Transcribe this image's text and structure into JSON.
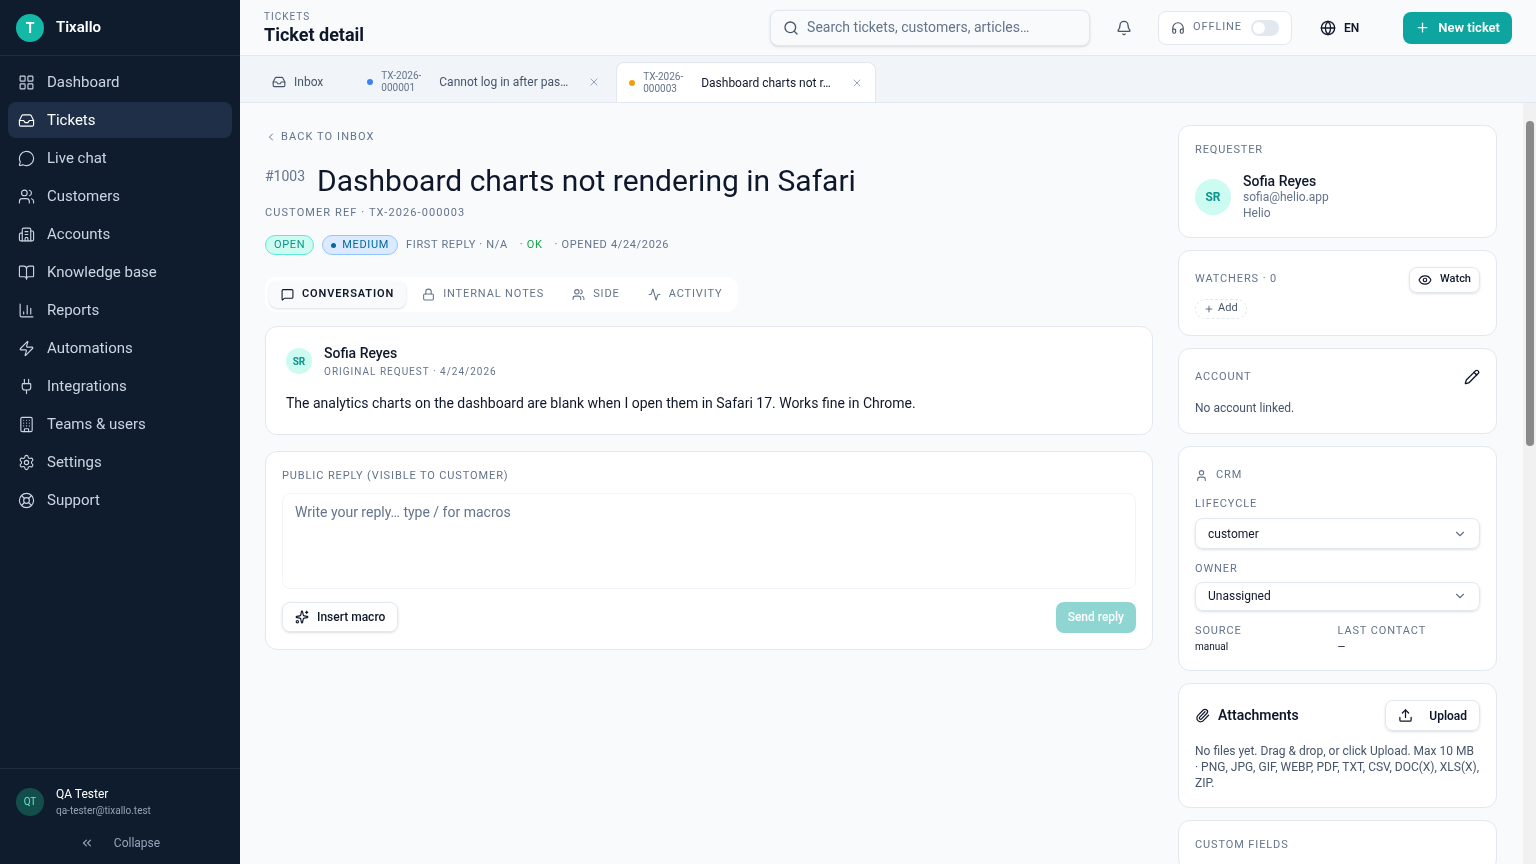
{
  "brand": {
    "logo": "T",
    "name": "Tixallo"
  },
  "sidebar": {
    "items": [
      {
        "label": "Dashboard",
        "selected": false
      },
      {
        "label": "Tickets",
        "selected": true
      },
      {
        "label": "Live chat",
        "selected": false
      },
      {
        "label": "Customers",
        "selected": false
      },
      {
        "label": "Accounts",
        "selected": false
      },
      {
        "label": "Knowledge base",
        "selected": false
      },
      {
        "label": "Reports",
        "selected": false
      },
      {
        "label": "Automations",
        "selected": false
      },
      {
        "label": "Integrations",
        "selected": false
      },
      {
        "label": "Teams & users",
        "selected": false
      },
      {
        "label": "Settings",
        "selected": false
      },
      {
        "label": "Support",
        "selected": false
      }
    ],
    "user": {
      "initials": "QT",
      "name": "QA Tester",
      "email": "qa-tester@tixallo.test"
    },
    "collapse": "Collapse"
  },
  "header": {
    "eyebrow": "TICKETS",
    "title": "Ticket detail",
    "search": {
      "placeholder": "Search tickets, customers, articles…"
    },
    "presence": {
      "label": "OFFLINE",
      "on": false
    },
    "language": "EN",
    "new_button": "New ticket"
  },
  "tabs": [
    {
      "kind": "inbox",
      "label": "Inbox",
      "selected": false
    },
    {
      "kind": "ticket",
      "ref": "TX-2026-000001",
      "label": "Cannot log in after pas…",
      "color": "#3b82f6",
      "selected": false
    },
    {
      "kind": "ticket",
      "ref": "TX-2026-000003",
      "label": "Dashboard charts not r…",
      "color": "#f59e0b",
      "selected": true
    }
  ],
  "ticket": {
    "back": "BACK TO INBOX",
    "number": "#1003",
    "title": "Dashboard charts not rendering in Safari",
    "customer_ref": "CUSTOMER REF · TX-2026-000003",
    "status": "OPEN",
    "priority": "MEDIUM",
    "first_reply": "FIRST REPLY · N/A",
    "sla": "· OK",
    "opened": "· OPENED 4/24/2026",
    "view_tabs": [
      {
        "label": "CONVERSATION",
        "selected": true
      },
      {
        "label": "INTERNAL NOTES",
        "selected": false
      },
      {
        "label": "SIDE",
        "selected": false
      },
      {
        "label": "ACTIVITY",
        "selected": false
      }
    ],
    "message": {
      "initials": "SR",
      "author": "Sofia Reyes",
      "meta": "ORIGINAL REQUEST · 4/24/2026",
      "body": "The analytics charts on the dashboard are blank when I open them in Safari 17. Works fine in Chrome."
    },
    "reply": {
      "label": "PUBLIC REPLY (VISIBLE TO CUSTOMER)",
      "placeholder": "Write your reply… type / for macros",
      "macro_button": "Insert macro",
      "send_button": "Send reply",
      "send_disabled": true
    }
  },
  "details": {
    "requester": {
      "heading": "REQUESTER",
      "initials": "SR",
      "name": "Sofia Reyes",
      "email": "sofia@helio.app",
      "company": "Helio"
    },
    "watchers": {
      "heading": "WATCHERS · 0",
      "watch_button": "Watch",
      "add_button": "Add"
    },
    "account": {
      "heading": "ACCOUNT",
      "text": "No account linked."
    },
    "crm": {
      "heading": "CRM",
      "lifecycle_label": "LIFECYCLE",
      "lifecycle": "customer",
      "owner_label": "OWNER",
      "owner": "Unassigned",
      "source_label": "SOURCE",
      "source": "manual",
      "last_contact_label": "LAST CONTACT",
      "last_contact": "—"
    },
    "attachments": {
      "heading": "Attachments",
      "upload_button": "Upload",
      "text": "No files yet. Drag & drop, or click Upload. Max 10 MB · PNG, JPG, GIF, WEBP, PDF, TXT, CSV, DOC(X), XLS(X), ZIP."
    },
    "custom_fields": {
      "heading": "CUSTOM FIELDS"
    }
  }
}
